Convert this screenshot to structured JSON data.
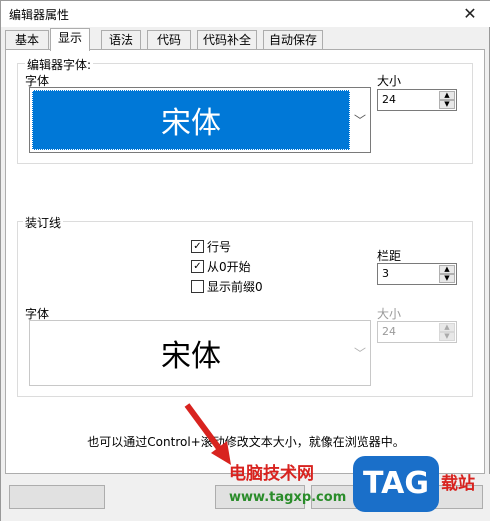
{
  "window": {
    "title": "编辑器属性",
    "close_glyph": "✕"
  },
  "tabs": [
    {
      "label": "基本",
      "active": false
    },
    {
      "label": "显示",
      "active": true
    },
    {
      "label": "语法",
      "active": false
    },
    {
      "label": "代码",
      "active": false
    },
    {
      "label": "代码补全",
      "active": false
    },
    {
      "label": "自动保存",
      "active": false
    }
  ],
  "editor_font": {
    "group_label": "编辑器字体:",
    "font_label": "字体",
    "font_value": "宋体",
    "size_label": "大小",
    "size_value": "24"
  },
  "gutter": {
    "group_label": "装订线",
    "checkboxes": [
      {
        "label": "行号",
        "checked": true
      },
      {
        "label": "从0开始",
        "checked": true
      },
      {
        "label": "显示前缀0",
        "checked": false
      }
    ],
    "margin_label": "栏距",
    "margin_value": "3",
    "font_label": "字体",
    "font_value": "宋体",
    "size_label": "大小",
    "size_value": "24"
  },
  "hint": "也可以通过Control+滚动修改文本大小，就像在浏览器中。",
  "watermark": {
    "brand": "电脑技术网",
    "url": "www.tagxp.com",
    "logo": "TAG",
    "side": "载站",
    "brand_color": "#d8231f",
    "logo_color": "#1a6fc9"
  },
  "colors": {
    "selection": "#0078d7",
    "window_bg": "#f0f0f0"
  }
}
